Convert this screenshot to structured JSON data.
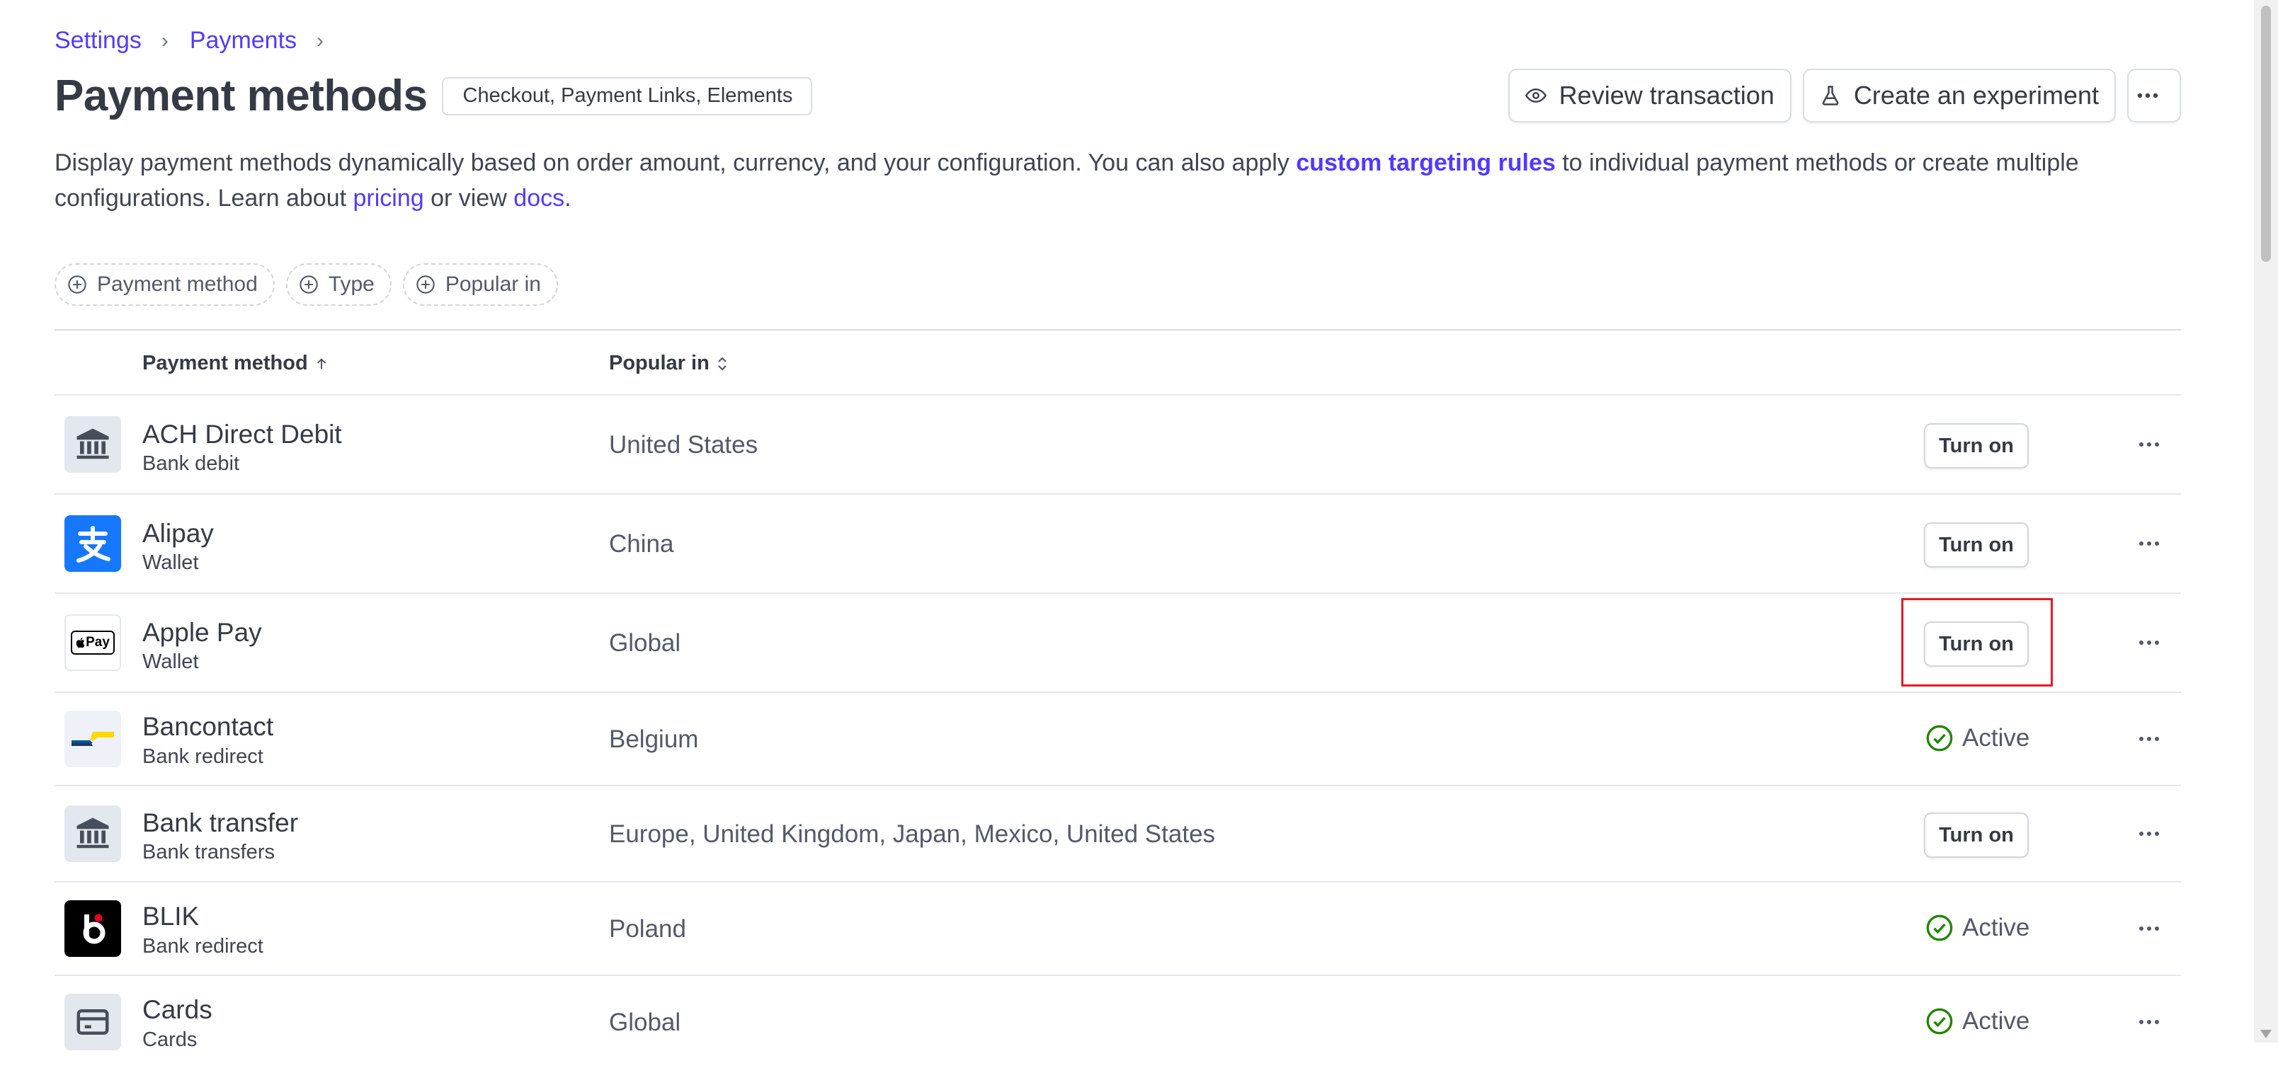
{
  "breadcrumb": {
    "items": [
      "Settings",
      "Payments"
    ],
    "separator": "›"
  },
  "header": {
    "title": "Payment methods",
    "tag": "Checkout, Payment Links, Elements",
    "review_button": "Review transaction",
    "experiment_button": "Create an experiment"
  },
  "description": {
    "part1": "Display payment methods dynamically based on order amount, currency, and your configuration. You can also apply ",
    "link_targeting": "custom targeting rules",
    "part2": " to individual payment methods or create multiple configurations. Learn about ",
    "link_pricing": "pricing",
    "part3": " or view ",
    "link_docs": "docs",
    "part4": "."
  },
  "filters": [
    "Payment method",
    "Type",
    "Popular in"
  ],
  "table": {
    "columns": {
      "method": "Payment method",
      "popular": "Popular in"
    },
    "turn_on_label": "Turn on",
    "active_label": "Active",
    "rows": [
      {
        "name": "ACH Direct Debit",
        "type": "Bank debit",
        "popular": "United States",
        "status": "off",
        "logo": "bank-icon"
      },
      {
        "name": "Alipay",
        "type": "Wallet",
        "popular": "China",
        "status": "off",
        "logo": "alipay-logo"
      },
      {
        "name": "Apple Pay",
        "type": "Wallet",
        "popular": "Global",
        "status": "off",
        "logo": "apple-pay-logo",
        "logo_text": "Pay"
      },
      {
        "name": "Bancontact",
        "type": "Bank redirect",
        "popular": "Belgium",
        "status": "active",
        "logo": "bancontact-logo"
      },
      {
        "name": "Bank transfer",
        "type": "Bank transfers",
        "popular": "Europe, United Kingdom, Japan, Mexico, United States",
        "status": "off",
        "logo": "bank-icon"
      },
      {
        "name": "BLIK",
        "type": "Bank redirect",
        "popular": "Poland",
        "status": "active",
        "logo": "blik-logo"
      },
      {
        "name": "Cards",
        "type": "Cards",
        "popular": "Global",
        "status": "active",
        "logo": "card-icon"
      }
    ]
  },
  "colors": {
    "accent": "#533afd",
    "success": "#228403",
    "highlight": "#e11d2a"
  }
}
